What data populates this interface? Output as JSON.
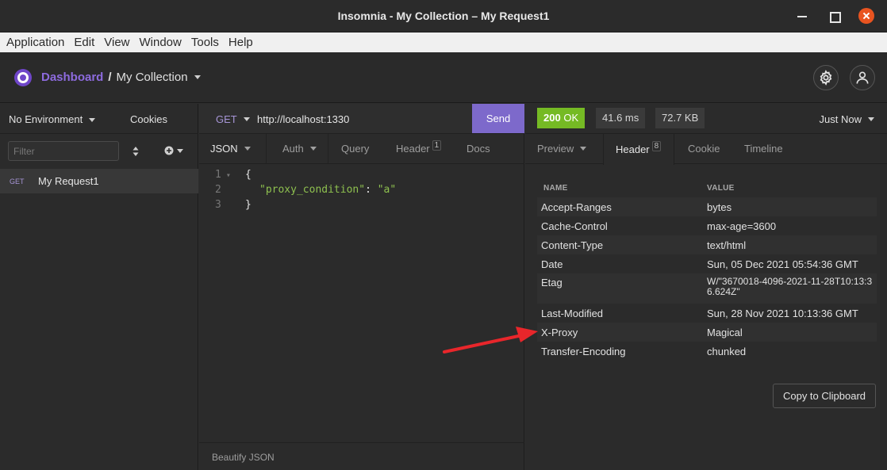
{
  "window": {
    "title": "Insomnia - My Collection – My Request1"
  },
  "menu": [
    "Application",
    "Edit",
    "View",
    "Window",
    "Tools",
    "Help"
  ],
  "header": {
    "dashboard": "Dashboard",
    "separator": "/",
    "collection": "My Collection",
    "icons": [
      "gear-icon",
      "user-icon"
    ]
  },
  "sidebar": {
    "environment": "No Environment",
    "cookies": "Cookies",
    "filter_placeholder": "Filter",
    "requests": [
      {
        "method": "GET",
        "name": "My Request1"
      }
    ]
  },
  "request": {
    "method": "GET",
    "url": "http://localhost:1330",
    "send_label": "Send",
    "tabs": [
      {
        "label": "JSON",
        "active": true
      },
      {
        "label": "Auth"
      },
      {
        "label": "Query"
      },
      {
        "label": "Header",
        "badge": "1"
      },
      {
        "label": "Docs"
      }
    ],
    "body_lines": [
      {
        "n": "1",
        "text": "{"
      },
      {
        "n": "2",
        "key": "\"proxy_condition\"",
        "sep": ": ",
        "val": "\"a\""
      },
      {
        "n": "3",
        "text": "}"
      }
    ],
    "footer": "Beautify JSON"
  },
  "response": {
    "status_code": "200",
    "status_text": "OK",
    "time": "41.6 ms",
    "size": "72.7 KB",
    "when": "Just Now",
    "tabs": [
      {
        "label": "Preview"
      },
      {
        "label": "Header",
        "badge": "8",
        "active": true
      },
      {
        "label": "Cookie"
      },
      {
        "label": "Timeline"
      }
    ],
    "columns": {
      "name": "NAME",
      "value": "VALUE"
    },
    "headers": [
      {
        "name": "Accept-Ranges",
        "value": "bytes"
      },
      {
        "name": "Cache-Control",
        "value": "max-age=3600"
      },
      {
        "name": "Content-Type",
        "value": "text/html"
      },
      {
        "name": "Date",
        "value": "Sun, 05 Dec 2021 05:54:36 GMT"
      },
      {
        "name": "Etag",
        "value": "W/\"3670018-4096-2021-11-28T10:13:36.624Z\""
      },
      {
        "name": "Last-Modified",
        "value": "Sun, 28 Nov 2021 10:13:36 GMT"
      },
      {
        "name": "X-Proxy",
        "value": "Magical"
      },
      {
        "name": "Transfer-Encoding",
        "value": "chunked"
      }
    ],
    "copy_label": "Copy to Clipboard"
  },
  "colors": {
    "accent": "#7d69cb",
    "ok": "#75ba24",
    "annotation": "#e8262b"
  }
}
